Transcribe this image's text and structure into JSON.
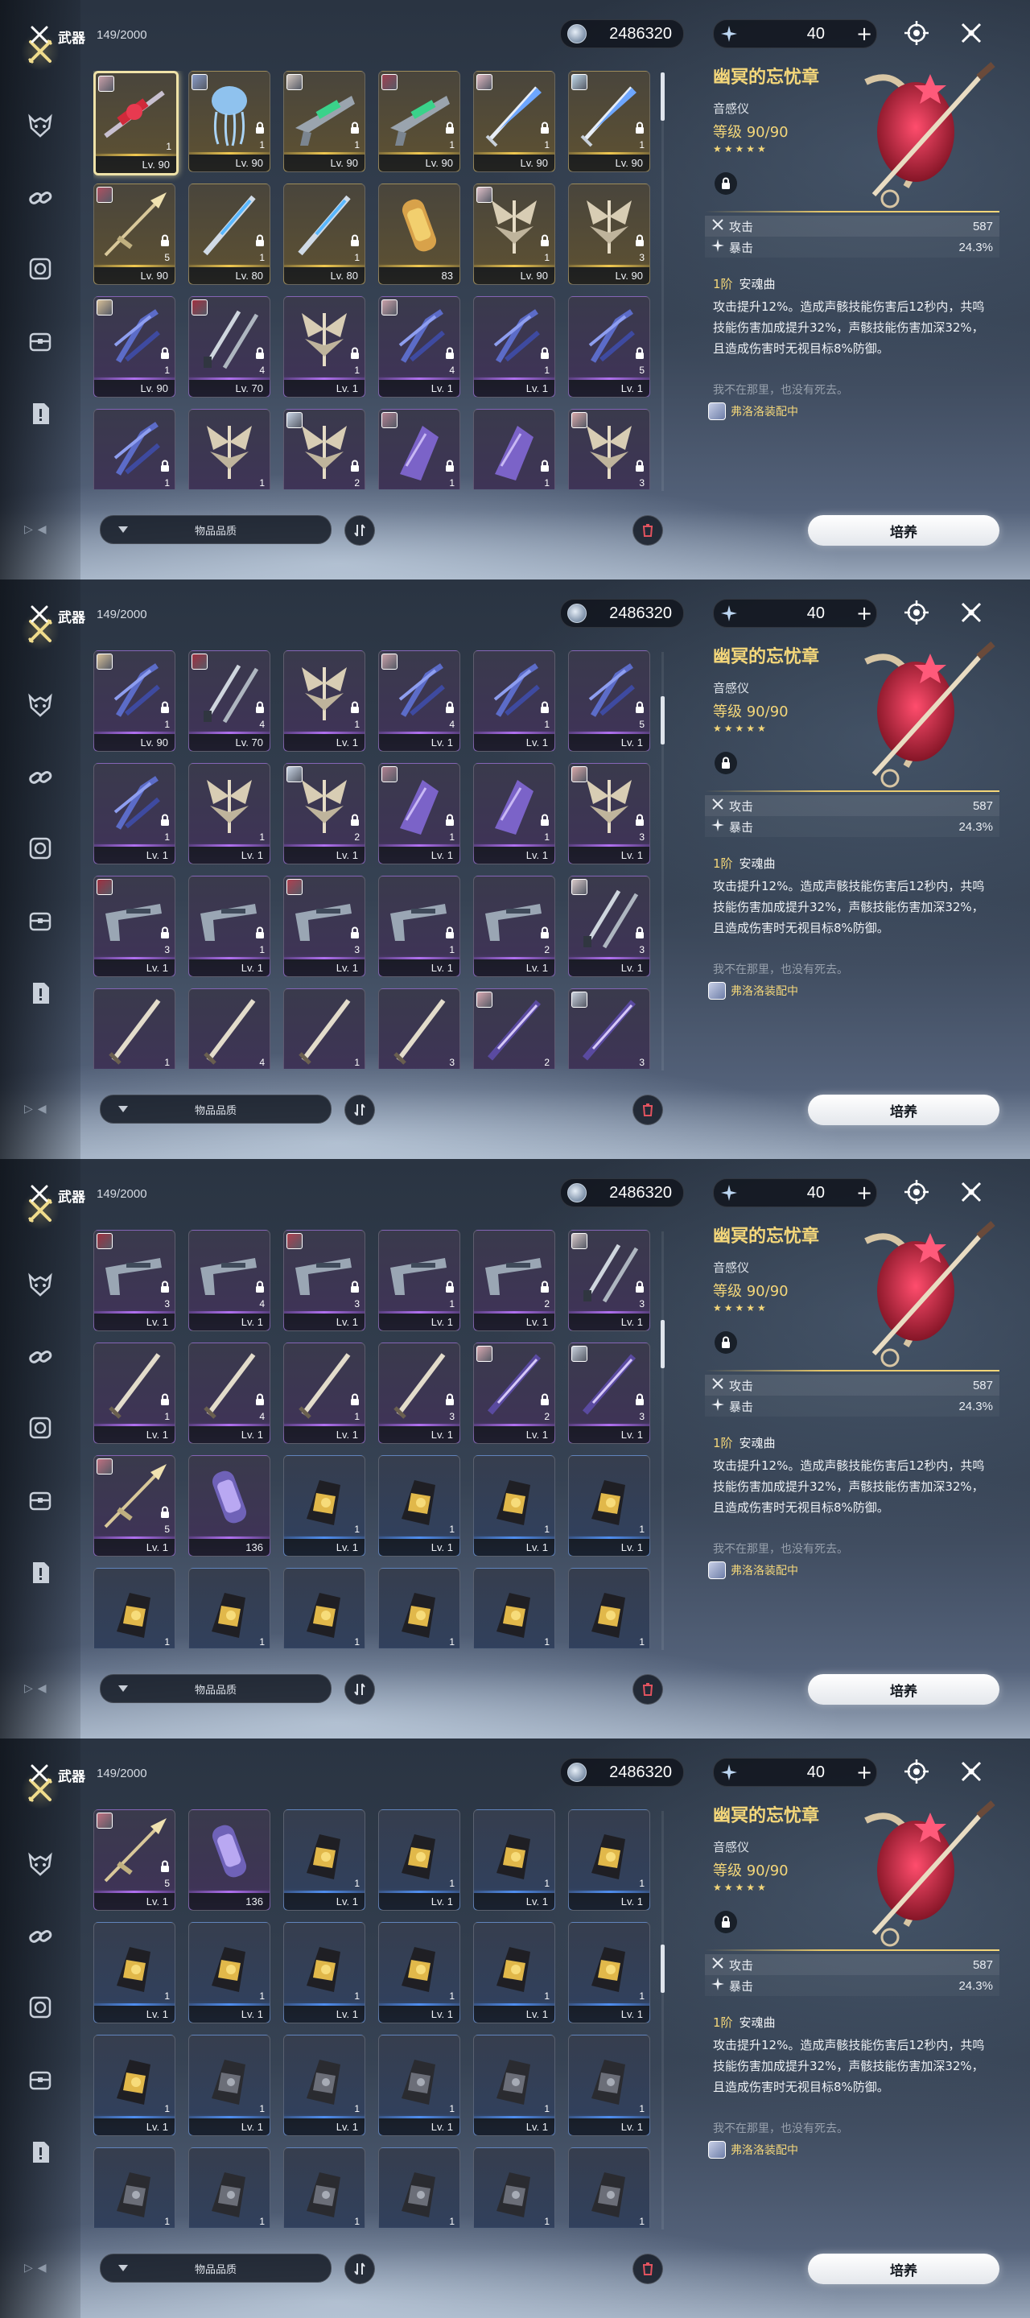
{
  "header": {
    "title": "武器",
    "count": "149/2000"
  },
  "currency": {
    "coins": "2486320",
    "tide": "40",
    "plus": "+"
  },
  "filter": {
    "label": "物品品质"
  },
  "detail": {
    "name": "幽冥的忘忧章",
    "type": "音感仪",
    "level_label": "等级",
    "level": "90/90",
    "stars": "★★★★★",
    "stats": [
      {
        "name": "攻击",
        "value": "587"
      },
      {
        "name": "暴击",
        "value": "24.3%"
      }
    ],
    "passive_tier": "1阶",
    "passive_name": "安魂曲",
    "passive_text": "攻击提升12%。造成声骸技能伤害后12秒内，共鸣技能伤害加成提升32%，声骸技能伤害加深32%，且造成伤害时无视目标8%防御。",
    "quote": "我不在那里，也没有死去。",
    "equipped_by": "弗洛洛装配中",
    "cultivate_label": "培养"
  },
  "colors": {
    "accent_gold": "#f4d77a",
    "rarity_gold": "#f0c850",
    "rarity_purple": "#b070f0",
    "rarity_blue": "#4f8ef0"
  },
  "panels": [
    {
      "scroll": 0.0,
      "rows": [
        [
          {
            "r": "gold",
            "lvl": "Lv. 90",
            "rank": "1",
            "av": "#c9a0a8",
            "lock": false,
            "sel": true,
            "w": "rifle-red"
          },
          {
            "r": "gold",
            "lvl": "Lv. 90",
            "rank": "1",
            "av": "#8a9cc8",
            "lock": true,
            "w": "jelly"
          },
          {
            "r": "gold",
            "lvl": "Lv. 90",
            "rank": "1",
            "av": "#d6c9c0",
            "lock": true,
            "w": "gun-green"
          },
          {
            "r": "gold",
            "lvl": "Lv. 90",
            "rank": "1",
            "av": "#a04050",
            "lock": true,
            "w": "gun-green"
          },
          {
            "r": "gold",
            "lvl": "Lv. 90",
            "rank": "1",
            "av": "#e0b8c0",
            "lock": true,
            "w": "sword-blue"
          },
          {
            "r": "gold",
            "lvl": "Lv. 90",
            "rank": "1",
            "av": "#c0d8e8",
            "lock": true,
            "w": "sword-blue"
          }
        ],
        [
          {
            "r": "gold",
            "lvl": "Lv. 90",
            "rank": "5",
            "av": "#b05060",
            "lock": true,
            "w": "spear"
          },
          {
            "r": "gold",
            "lvl": "Lv. 80",
            "rank": "1",
            "av": "",
            "lock": true,
            "w": "blade-blue"
          },
          {
            "r": "gold",
            "lvl": "Lv. 80",
            "rank": "1",
            "av": "",
            "lock": true,
            "w": "blade-blue"
          },
          {
            "r": "gold",
            "lvl": "83",
            "rank": "",
            "av": "",
            "lock": false,
            "w": "capsule-gold"
          },
          {
            "r": "gold",
            "lvl": "Lv. 90",
            "rank": "1",
            "av": "#e0c0c8",
            "lock": true,
            "w": "wings"
          },
          {
            "r": "gold",
            "lvl": "Lv. 90",
            "rank": "3",
            "av": "",
            "lock": true,
            "w": "wings"
          }
        ],
        [
          {
            "r": "purple",
            "lvl": "Lv. 90",
            "rank": "1",
            "av": "#d8c098",
            "lock": true,
            "w": "claws"
          },
          {
            "r": "purple",
            "lvl": "Lv. 70",
            "rank": "4",
            "av": "#a03040",
            "lock": true,
            "w": "dual"
          },
          {
            "r": "purple",
            "lvl": "Lv. 1",
            "rank": "1",
            "av": "",
            "lock": true,
            "w": "wings"
          },
          {
            "r": "purple",
            "lvl": "Lv. 1",
            "rank": "4",
            "av": "#c8a0a8",
            "lock": true,
            "w": "claws"
          },
          {
            "r": "purple",
            "lvl": "Lv. 1",
            "rank": "1",
            "av": "",
            "lock": true,
            "w": "claws"
          },
          {
            "r": "purple",
            "lvl": "Lv. 1",
            "rank": "5",
            "av": "",
            "lock": true,
            "w": "claws"
          }
        ],
        [
          {
            "r": "purple",
            "lvl": "",
            "rank": "1",
            "av": "",
            "lock": true,
            "w": "claws"
          },
          {
            "r": "purple",
            "lvl": "",
            "rank": "1",
            "av": "",
            "lock": false,
            "w": "wings"
          },
          {
            "r": "purple",
            "lvl": "",
            "rank": "2",
            "av": "#c8d4e4",
            "lock": true,
            "w": "wings"
          },
          {
            "r": "purple",
            "lvl": "",
            "rank": "1",
            "av": "#b08090",
            "lock": true,
            "w": "gauntlet"
          },
          {
            "r": "purple",
            "lvl": "",
            "rank": "1",
            "av": "",
            "lock": true,
            "w": "gauntlet"
          },
          {
            "r": "purple",
            "lvl": "",
            "rank": "3",
            "av": "#d8a8a8",
            "lock": true,
            "w": "wings"
          }
        ]
      ]
    },
    {
      "scroll": 0.12,
      "rows": [
        [
          {
            "r": "purple",
            "lvl": "Lv. 90",
            "rank": "1",
            "av": "#d8c098",
            "lock": true,
            "w": "claws"
          },
          {
            "r": "purple",
            "lvl": "Lv. 70",
            "rank": "4",
            "av": "#a03040",
            "lock": true,
            "w": "dual"
          },
          {
            "r": "purple",
            "lvl": "Lv. 1",
            "rank": "1",
            "av": "",
            "lock": true,
            "w": "wings"
          },
          {
            "r": "purple",
            "lvl": "Lv. 1",
            "rank": "4",
            "av": "#c8a0a8",
            "lock": true,
            "w": "claws"
          },
          {
            "r": "purple",
            "lvl": "Lv. 1",
            "rank": "1",
            "av": "",
            "lock": true,
            "w": "claws"
          },
          {
            "r": "purple",
            "lvl": "Lv. 1",
            "rank": "5",
            "av": "",
            "lock": true,
            "w": "claws"
          }
        ],
        [
          {
            "r": "purple",
            "lvl": "Lv. 1",
            "rank": "1",
            "av": "",
            "lock": true,
            "w": "claws"
          },
          {
            "r": "purple",
            "lvl": "Lv. 1",
            "rank": "1",
            "av": "",
            "lock": false,
            "w": "wings"
          },
          {
            "r": "purple",
            "lvl": "Lv. 1",
            "rank": "2",
            "av": "#c8d4e4",
            "lock": true,
            "w": "wings"
          },
          {
            "r": "purple",
            "lvl": "Lv. 1",
            "rank": "1",
            "av": "#b08090",
            "lock": true,
            "w": "gauntlet"
          },
          {
            "r": "purple",
            "lvl": "Lv. 1",
            "rank": "1",
            "av": "",
            "lock": true,
            "w": "gauntlet"
          },
          {
            "r": "purple",
            "lvl": "Lv. 1",
            "rank": "3",
            "av": "#d8a8a8",
            "lock": true,
            "w": "wings"
          }
        ],
        [
          {
            "r": "purple",
            "lvl": "Lv. 1",
            "rank": "3",
            "av": "#a03040",
            "lock": true,
            "w": "pistol"
          },
          {
            "r": "purple",
            "lvl": "Lv. 1",
            "rank": "1",
            "av": "",
            "lock": true,
            "w": "pistol"
          },
          {
            "r": "purple",
            "lvl": "Lv. 1",
            "rank": "3",
            "av": "#b04050",
            "lock": true,
            "w": "pistol"
          },
          {
            "r": "purple",
            "lvl": "Lv. 1",
            "rank": "1",
            "av": "",
            "lock": true,
            "w": "pistol"
          },
          {
            "r": "purple",
            "lvl": "Lv. 1",
            "rank": "2",
            "av": "",
            "lock": true,
            "w": "pistol"
          },
          {
            "r": "purple",
            "lvl": "Lv. 1",
            "rank": "3",
            "av": "#d8c8c8",
            "lock": true,
            "w": "dual"
          }
        ],
        [
          {
            "r": "purple",
            "lvl": "",
            "rank": "1",
            "av": "",
            "lock": false,
            "w": "blade"
          },
          {
            "r": "purple",
            "lvl": "",
            "rank": "4",
            "av": "",
            "lock": false,
            "w": "blade"
          },
          {
            "r": "purple",
            "lvl": "",
            "rank": "1",
            "av": "",
            "lock": false,
            "w": "blade"
          },
          {
            "r": "purple",
            "lvl": "",
            "rank": "3",
            "av": "",
            "lock": false,
            "w": "blade"
          },
          {
            "r": "purple",
            "lvl": "",
            "rank": "2",
            "av": "#d8a8b0",
            "lock": false,
            "w": "sword-purple"
          },
          {
            "r": "purple",
            "lvl": "",
            "rank": "3",
            "av": "#c8d0dc",
            "lock": false,
            "w": "sword-purple"
          }
        ]
      ]
    },
    {
      "scroll": 0.24,
      "rows": [
        [
          {
            "r": "purple",
            "lvl": "Lv. 1",
            "rank": "3",
            "av": "#a03040",
            "lock": true,
            "w": "pistol"
          },
          {
            "r": "purple",
            "lvl": "Lv. 1",
            "rank": "4",
            "av": "",
            "lock": true,
            "w": "pistol"
          },
          {
            "r": "purple",
            "lvl": "Lv. 1",
            "rank": "3",
            "av": "#b04050",
            "lock": true,
            "w": "pistol"
          },
          {
            "r": "purple",
            "lvl": "Lv. 1",
            "rank": "1",
            "av": "",
            "lock": true,
            "w": "pistol"
          },
          {
            "r": "purple",
            "lvl": "Lv. 1",
            "rank": "2",
            "av": "",
            "lock": true,
            "w": "pistol"
          },
          {
            "r": "purple",
            "lvl": "Lv. 1",
            "rank": "3",
            "av": "#d8c8c8",
            "lock": true,
            "w": "dual"
          }
        ],
        [
          {
            "r": "purple",
            "lvl": "Lv. 1",
            "rank": "1",
            "av": "",
            "lock": true,
            "w": "blade"
          },
          {
            "r": "purple",
            "lvl": "Lv. 1",
            "rank": "4",
            "av": "",
            "lock": true,
            "w": "blade"
          },
          {
            "r": "purple",
            "lvl": "Lv. 1",
            "rank": "1",
            "av": "",
            "lock": true,
            "w": "blade"
          },
          {
            "r": "purple",
            "lvl": "Lv. 1",
            "rank": "3",
            "av": "",
            "lock": true,
            "w": "blade"
          },
          {
            "r": "purple",
            "lvl": "Lv. 1",
            "rank": "2",
            "av": "#d8a8b0",
            "lock": true,
            "w": "sword-purple"
          },
          {
            "r": "purple",
            "lvl": "Lv. 1",
            "rank": "3",
            "av": "#c8d0dc",
            "lock": true,
            "w": "sword-purple"
          }
        ],
        [
          {
            "r": "purple",
            "lvl": "Lv. 1",
            "rank": "5",
            "av": "#c07080",
            "lock": true,
            "w": "spear"
          },
          {
            "r": "purple",
            "lvl": "136",
            "rank": "",
            "av": "",
            "lock": false,
            "w": "capsule-purple"
          },
          {
            "r": "blue",
            "lvl": "Lv. 1",
            "rank": "1",
            "av": "",
            "lock": false,
            "w": "gauntlet-gold"
          },
          {
            "r": "blue",
            "lvl": "Lv. 1",
            "rank": "1",
            "av": "",
            "lock": false,
            "w": "gauntlet-gold"
          },
          {
            "r": "blue",
            "lvl": "Lv. 1",
            "rank": "1",
            "av": "",
            "lock": false,
            "w": "gauntlet-gold"
          },
          {
            "r": "blue",
            "lvl": "Lv. 1",
            "rank": "1",
            "av": "",
            "lock": false,
            "w": "gauntlet-gold"
          }
        ],
        [
          {
            "r": "blue",
            "lvl": "",
            "rank": "1",
            "av": "",
            "lock": false,
            "w": "gauntlet-gold"
          },
          {
            "r": "blue",
            "lvl": "",
            "rank": "1",
            "av": "",
            "lock": false,
            "w": "gauntlet-gold"
          },
          {
            "r": "blue",
            "lvl": "",
            "rank": "1",
            "av": "",
            "lock": false,
            "w": "gauntlet-gold"
          },
          {
            "r": "blue",
            "lvl": "",
            "rank": "1",
            "av": "",
            "lock": false,
            "w": "gauntlet-gold"
          },
          {
            "r": "blue",
            "lvl": "",
            "rank": "1",
            "av": "",
            "lock": false,
            "w": "gauntlet-gold"
          },
          {
            "r": "blue",
            "lvl": "",
            "rank": "1",
            "av": "",
            "lock": false,
            "w": "gauntlet-gold"
          }
        ]
      ]
    },
    {
      "scroll": 0.36,
      "rows": [
        [
          {
            "r": "purple",
            "lvl": "Lv. 1",
            "rank": "5",
            "av": "#c07080",
            "lock": true,
            "w": "spear"
          },
          {
            "r": "purple",
            "lvl": "136",
            "rank": "",
            "av": "",
            "lock": false,
            "w": "capsule-purple"
          },
          {
            "r": "blue",
            "lvl": "Lv. 1",
            "rank": "1",
            "av": "",
            "lock": false,
            "w": "gauntlet-gold"
          },
          {
            "r": "blue",
            "lvl": "Lv. 1",
            "rank": "1",
            "av": "",
            "lock": false,
            "w": "gauntlet-gold"
          },
          {
            "r": "blue",
            "lvl": "Lv. 1",
            "rank": "1",
            "av": "",
            "lock": false,
            "w": "gauntlet-gold"
          },
          {
            "r": "blue",
            "lvl": "Lv. 1",
            "rank": "1",
            "av": "",
            "lock": false,
            "w": "gauntlet-gold"
          }
        ],
        [
          {
            "r": "blue",
            "lvl": "Lv. 1",
            "rank": "1",
            "av": "",
            "lock": false,
            "w": "gauntlet-gold"
          },
          {
            "r": "blue",
            "lvl": "Lv. 1",
            "rank": "1",
            "av": "",
            "lock": false,
            "w": "gauntlet-gold"
          },
          {
            "r": "blue",
            "lvl": "Lv. 1",
            "rank": "1",
            "av": "",
            "lock": false,
            "w": "gauntlet-gold"
          },
          {
            "r": "blue",
            "lvl": "Lv. 1",
            "rank": "1",
            "av": "",
            "lock": false,
            "w": "gauntlet-gold"
          },
          {
            "r": "blue",
            "lvl": "Lv. 1",
            "rank": "1",
            "av": "",
            "lock": false,
            "w": "gauntlet-gold"
          },
          {
            "r": "blue",
            "lvl": "Lv. 1",
            "rank": "1",
            "av": "",
            "lock": false,
            "w": "gauntlet-gold"
          }
        ],
        [
          {
            "r": "blue",
            "lvl": "Lv. 1",
            "rank": "1",
            "av": "",
            "lock": false,
            "w": "gauntlet-gold"
          },
          {
            "r": "blue",
            "lvl": "Lv. 1",
            "rank": "1",
            "av": "",
            "lock": false,
            "w": "gauntlet-dark"
          },
          {
            "r": "blue",
            "lvl": "Lv. 1",
            "rank": "1",
            "av": "",
            "lock": false,
            "w": "gauntlet-dark"
          },
          {
            "r": "blue",
            "lvl": "Lv. 1",
            "rank": "1",
            "av": "",
            "lock": false,
            "w": "gauntlet-dark"
          },
          {
            "r": "blue",
            "lvl": "Lv. 1",
            "rank": "1",
            "av": "",
            "lock": false,
            "w": "gauntlet-dark"
          },
          {
            "r": "blue",
            "lvl": "Lv. 1",
            "rank": "1",
            "av": "",
            "lock": false,
            "w": "gauntlet-dark"
          }
        ],
        [
          {
            "r": "blue",
            "lvl": "",
            "rank": "1",
            "av": "",
            "lock": false,
            "w": "gauntlet-dark"
          },
          {
            "r": "blue",
            "lvl": "",
            "rank": "1",
            "av": "",
            "lock": false,
            "w": "gauntlet-dark"
          },
          {
            "r": "blue",
            "lvl": "",
            "rank": "1",
            "av": "",
            "lock": false,
            "w": "gauntlet-dark"
          },
          {
            "r": "blue",
            "lvl": "",
            "rank": "1",
            "av": "",
            "lock": false,
            "w": "gauntlet-dark"
          },
          {
            "r": "blue",
            "lvl": "",
            "rank": "1",
            "av": "",
            "lock": false,
            "w": "gauntlet-dark"
          },
          {
            "r": "blue",
            "lvl": "",
            "rank": "1",
            "av": "",
            "lock": false,
            "w": "gauntlet-dark"
          }
        ]
      ]
    }
  ]
}
